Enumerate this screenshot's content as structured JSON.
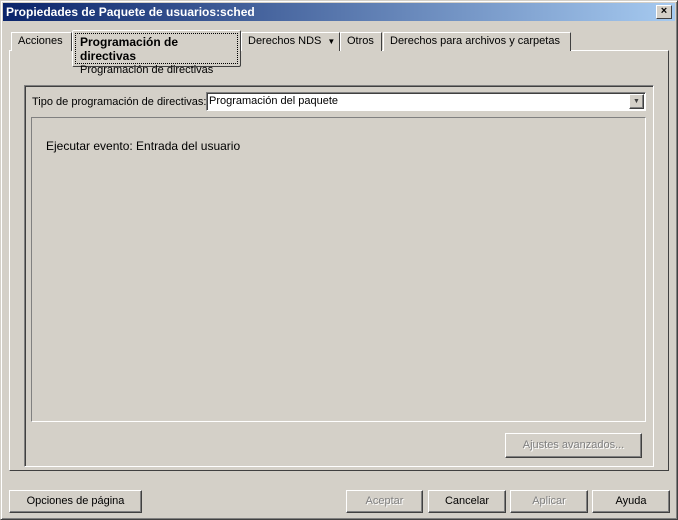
{
  "window": {
    "title": "Propiedades de Paquete de usuarios:sched",
    "close_label": "×"
  },
  "tabs": [
    {
      "label": "Acciones"
    },
    {
      "label": "Programación de directivas",
      "sublabel": "Programación de directivas",
      "active": true
    },
    {
      "label": "Derechos NDS",
      "has_dropdown": true
    },
    {
      "label": "Otros"
    },
    {
      "label": "Derechos para archivos y carpetas"
    }
  ],
  "content": {
    "type_label": "Tipo de programación de directivas:",
    "type_value": "Programación del paquete",
    "event_text": "Ejecutar evento: Entrada del usuario",
    "advanced_button": "Ajustes avanzados..."
  },
  "footer": {
    "page_options": "Opciones de página",
    "ok": "Aceptar",
    "cancel": "Cancelar",
    "apply": "Aplicar",
    "help": "Ayuda"
  }
}
